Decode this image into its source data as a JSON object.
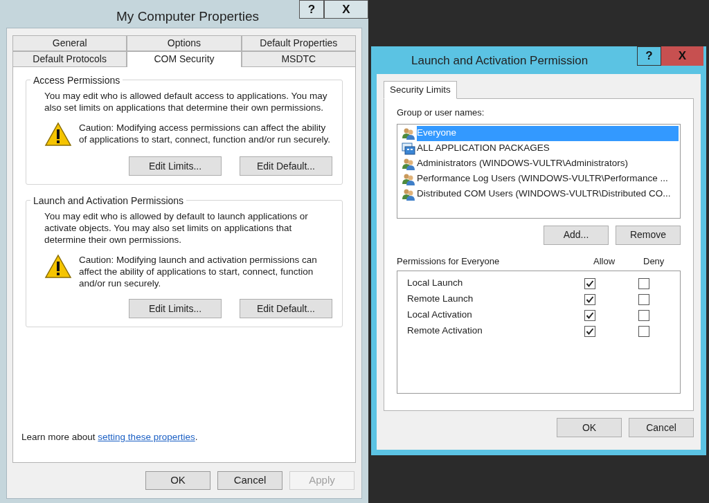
{
  "properties_window": {
    "title": "My Computer Properties",
    "title_buttons": [
      "?",
      "X"
    ],
    "tab_rows": [
      [
        {
          "label": "General",
          "selected": false
        },
        {
          "label": "Options",
          "selected": false
        },
        {
          "label": "Default Properties",
          "selected": false
        }
      ],
      [
        {
          "label": "Default Protocols",
          "selected": false
        },
        {
          "label": "COM Security",
          "selected": true
        },
        {
          "label": "MSDTC",
          "selected": false
        }
      ]
    ],
    "groups": [
      {
        "title": "Access Permissions",
        "description": "You may edit who is allowed default access to applications. You may also set limits on applications that determine their own permissions.",
        "caution": "Caution: Modifying access permissions can affect the ability of applications to start, connect, function and/or run securely.",
        "buttons": [
          "Edit Limits...",
          "Edit Default..."
        ]
      },
      {
        "title": "Launch and Activation Permissions",
        "description": "You may edit who is allowed by default to launch applications or activate objects. You may also set limits on applications that determine their own permissions.",
        "caution": "Caution: Modifying launch and activation permissions can affect the ability of applications to start, connect, function and/or run securely.",
        "buttons": [
          "Edit Limits...",
          "Edit Default..."
        ]
      }
    ],
    "learn_more": {
      "text": "Learn more about",
      "link": "setting these properties",
      "suffix": "."
    },
    "buttons": [
      {
        "label": "OK",
        "disabled": false
      },
      {
        "label": "Cancel",
        "disabled": false
      },
      {
        "label": "Apply",
        "disabled": true
      }
    ]
  },
  "permission_dialog": {
    "title": "Launch and Activation Permission",
    "title_buttons": [
      "?",
      "X"
    ],
    "tabs": [
      {
        "label": "Security Limits",
        "selected": true
      }
    ],
    "group_label": "Group or user names:",
    "users": [
      {
        "name": "Everyone",
        "kind": "group",
        "selected": true
      },
      {
        "name": "ALL APPLICATION PACKAGES",
        "kind": "packages",
        "selected": false
      },
      {
        "name": "Administrators (WINDOWS-VULTR\\Administrators)",
        "kind": "group",
        "selected": false
      },
      {
        "name": "Performance Log Users (WINDOWS-VULTR\\Performance ...",
        "kind": "group",
        "selected": false
      },
      {
        "name": "Distributed COM Users (WINDOWS-VULTR\\Distributed CO...",
        "kind": "group",
        "selected": false
      }
    ],
    "user_buttons": [
      "Add...",
      "Remove"
    ],
    "permissions_label": "Permissions for Everyone",
    "allow_header": "Allow",
    "deny_header": "Deny",
    "permissions": [
      {
        "name": "Local Launch",
        "allow": true,
        "deny": false
      },
      {
        "name": "Remote Launch",
        "allow": true,
        "deny": false
      },
      {
        "name": "Local Activation",
        "allow": true,
        "deny": false
      },
      {
        "name": "Remote Activation",
        "allow": true,
        "deny": false
      }
    ],
    "buttons": [
      "OK",
      "Cancel"
    ]
  }
}
